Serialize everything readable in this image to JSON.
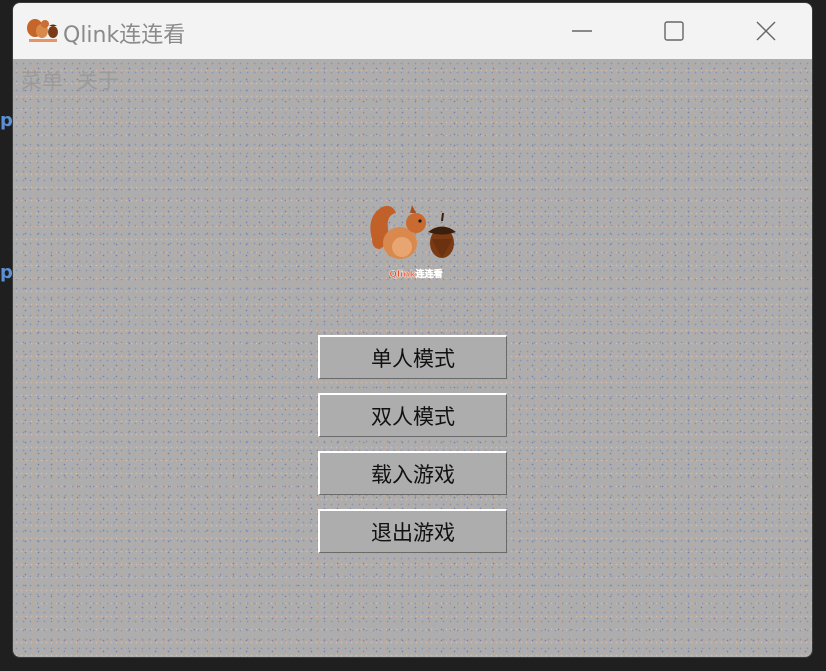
{
  "window": {
    "title": "Qlink连连看"
  },
  "menubar": {
    "items": [
      {
        "label": "菜单"
      },
      {
        "label": "关于"
      }
    ]
  },
  "logo": {
    "caption": "Qlink连连看",
    "icon": "squirrel-acorn-logo"
  },
  "buttons": [
    {
      "label": "单人模式"
    },
    {
      "label": "双人模式"
    },
    {
      "label": "载入游戏"
    },
    {
      "label": "退出游戏"
    }
  ],
  "window_controls": [
    "minimize-icon",
    "maximize-icon",
    "close-icon"
  ],
  "colors": {
    "titlebar": "#f3f3f3",
    "client_bg": "#adadad",
    "button_text": "#111111"
  }
}
